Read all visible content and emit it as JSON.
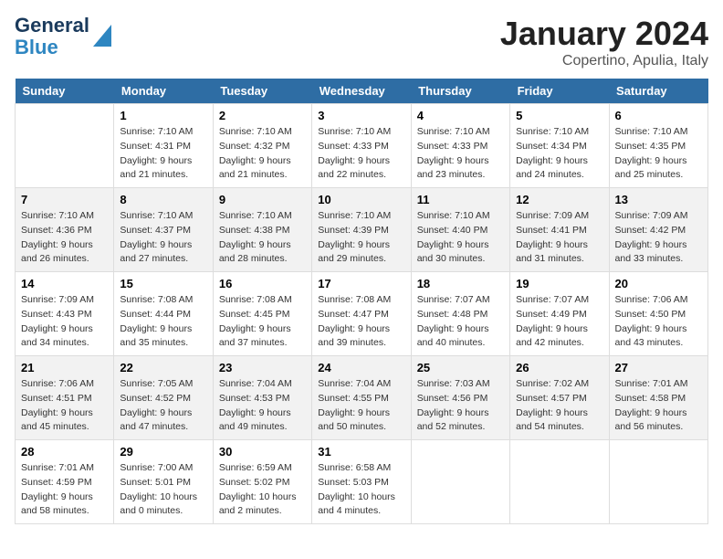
{
  "header": {
    "logo_line1": "General",
    "logo_line2": "Blue",
    "title": "January 2024",
    "subtitle": "Copertino, Apulia, Italy"
  },
  "days_of_week": [
    "Sunday",
    "Monday",
    "Tuesday",
    "Wednesday",
    "Thursday",
    "Friday",
    "Saturday"
  ],
  "weeks": [
    [
      {
        "day": "",
        "info": ""
      },
      {
        "day": "1",
        "info": "Sunrise: 7:10 AM\nSunset: 4:31 PM\nDaylight: 9 hours\nand 21 minutes."
      },
      {
        "day": "2",
        "info": "Sunrise: 7:10 AM\nSunset: 4:32 PM\nDaylight: 9 hours\nand 21 minutes."
      },
      {
        "day": "3",
        "info": "Sunrise: 7:10 AM\nSunset: 4:33 PM\nDaylight: 9 hours\nand 22 minutes."
      },
      {
        "day": "4",
        "info": "Sunrise: 7:10 AM\nSunset: 4:33 PM\nDaylight: 9 hours\nand 23 minutes."
      },
      {
        "day": "5",
        "info": "Sunrise: 7:10 AM\nSunset: 4:34 PM\nDaylight: 9 hours\nand 24 minutes."
      },
      {
        "day": "6",
        "info": "Sunrise: 7:10 AM\nSunset: 4:35 PM\nDaylight: 9 hours\nand 25 minutes."
      }
    ],
    [
      {
        "day": "7",
        "info": "Sunrise: 7:10 AM\nSunset: 4:36 PM\nDaylight: 9 hours\nand 26 minutes."
      },
      {
        "day": "8",
        "info": "Sunrise: 7:10 AM\nSunset: 4:37 PM\nDaylight: 9 hours\nand 27 minutes."
      },
      {
        "day": "9",
        "info": "Sunrise: 7:10 AM\nSunset: 4:38 PM\nDaylight: 9 hours\nand 28 minutes."
      },
      {
        "day": "10",
        "info": "Sunrise: 7:10 AM\nSunset: 4:39 PM\nDaylight: 9 hours\nand 29 minutes."
      },
      {
        "day": "11",
        "info": "Sunrise: 7:10 AM\nSunset: 4:40 PM\nDaylight: 9 hours\nand 30 minutes."
      },
      {
        "day": "12",
        "info": "Sunrise: 7:09 AM\nSunset: 4:41 PM\nDaylight: 9 hours\nand 31 minutes."
      },
      {
        "day": "13",
        "info": "Sunrise: 7:09 AM\nSunset: 4:42 PM\nDaylight: 9 hours\nand 33 minutes."
      }
    ],
    [
      {
        "day": "14",
        "info": "Sunrise: 7:09 AM\nSunset: 4:43 PM\nDaylight: 9 hours\nand 34 minutes."
      },
      {
        "day": "15",
        "info": "Sunrise: 7:08 AM\nSunset: 4:44 PM\nDaylight: 9 hours\nand 35 minutes."
      },
      {
        "day": "16",
        "info": "Sunrise: 7:08 AM\nSunset: 4:45 PM\nDaylight: 9 hours\nand 37 minutes."
      },
      {
        "day": "17",
        "info": "Sunrise: 7:08 AM\nSunset: 4:47 PM\nDaylight: 9 hours\nand 39 minutes."
      },
      {
        "day": "18",
        "info": "Sunrise: 7:07 AM\nSunset: 4:48 PM\nDaylight: 9 hours\nand 40 minutes."
      },
      {
        "day": "19",
        "info": "Sunrise: 7:07 AM\nSunset: 4:49 PM\nDaylight: 9 hours\nand 42 minutes."
      },
      {
        "day": "20",
        "info": "Sunrise: 7:06 AM\nSunset: 4:50 PM\nDaylight: 9 hours\nand 43 minutes."
      }
    ],
    [
      {
        "day": "21",
        "info": "Sunrise: 7:06 AM\nSunset: 4:51 PM\nDaylight: 9 hours\nand 45 minutes."
      },
      {
        "day": "22",
        "info": "Sunrise: 7:05 AM\nSunset: 4:52 PM\nDaylight: 9 hours\nand 47 minutes."
      },
      {
        "day": "23",
        "info": "Sunrise: 7:04 AM\nSunset: 4:53 PM\nDaylight: 9 hours\nand 49 minutes."
      },
      {
        "day": "24",
        "info": "Sunrise: 7:04 AM\nSunset: 4:55 PM\nDaylight: 9 hours\nand 50 minutes."
      },
      {
        "day": "25",
        "info": "Sunrise: 7:03 AM\nSunset: 4:56 PM\nDaylight: 9 hours\nand 52 minutes."
      },
      {
        "day": "26",
        "info": "Sunrise: 7:02 AM\nSunset: 4:57 PM\nDaylight: 9 hours\nand 54 minutes."
      },
      {
        "day": "27",
        "info": "Sunrise: 7:01 AM\nSunset: 4:58 PM\nDaylight: 9 hours\nand 56 minutes."
      }
    ],
    [
      {
        "day": "28",
        "info": "Sunrise: 7:01 AM\nSunset: 4:59 PM\nDaylight: 9 hours\nand 58 minutes."
      },
      {
        "day": "29",
        "info": "Sunrise: 7:00 AM\nSunset: 5:01 PM\nDaylight: 10 hours\nand 0 minutes."
      },
      {
        "day": "30",
        "info": "Sunrise: 6:59 AM\nSunset: 5:02 PM\nDaylight: 10 hours\nand 2 minutes."
      },
      {
        "day": "31",
        "info": "Sunrise: 6:58 AM\nSunset: 5:03 PM\nDaylight: 10 hours\nand 4 minutes."
      },
      {
        "day": "",
        "info": ""
      },
      {
        "day": "",
        "info": ""
      },
      {
        "day": "",
        "info": ""
      }
    ]
  ]
}
